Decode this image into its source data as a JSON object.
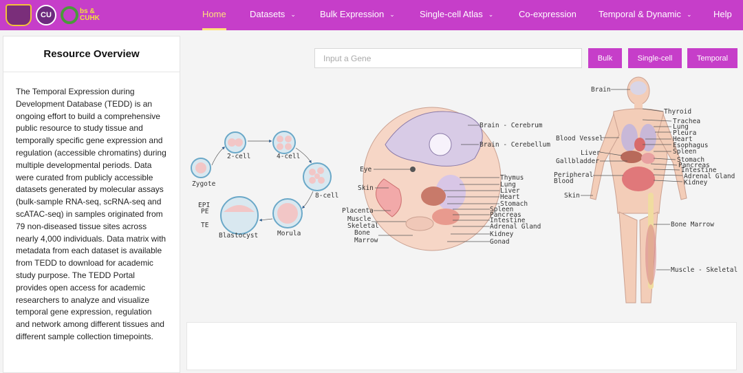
{
  "nav": {
    "logos": {
      "cu": "CU",
      "obs_text_1": "bs &",
      "obs_text_2": "CUHK"
    },
    "items": [
      {
        "label": "Home",
        "dropdown": false,
        "active": true
      },
      {
        "label": "Datasets",
        "dropdown": true
      },
      {
        "label": "Bulk Expression",
        "dropdown": true
      },
      {
        "label": "Single-cell Atlas",
        "dropdown": true
      },
      {
        "label": "Co-expression",
        "dropdown": false
      },
      {
        "label": "Temporal & Dynamic",
        "dropdown": true
      },
      {
        "label": "Help",
        "dropdown": false
      }
    ]
  },
  "overview": {
    "title": "Resource Overview",
    "text": "The Temporal Expression during Development Database (TEDD) is an ongoing effort to build a comprehensive public resource to study tissue and temporally specific gene expression and regulation (accessible chromatins) during multiple developmental periods. Data were curated from publicly accessible datasets generated by molecular assays (bulk-sample RNA-seq, scRNA-seq and scATAC-seq) in samples originated from 79 non-diseased tissue sites across nearly 4,000 individuals. Data matrix with metadata from each dataset is available from TEDD to download for academic study purpose. The TEDD Portal provides open access for academic researchers to analyze and visualize temporal gene expression, regulation and network among different tissues and different sample collection timepoints."
  },
  "search": {
    "placeholder": "Input a Gene",
    "buttons": [
      "Bulk",
      "Single-cell",
      "Temporal"
    ]
  },
  "figure": {
    "embryo_stages": {
      "zygote": "Zygote",
      "cell2": "2-cell",
      "cell4": "4-cell",
      "cell8": "8-cell",
      "morula": "Morula",
      "blastocyst": "Blastocyst",
      "epi": "EPI",
      "pe": "PE",
      "te": "TE"
    },
    "fetus_labels": {
      "cerebrum": "Brain - Cerebrum",
      "cerebellum": "Brain - Cerebellum",
      "eye": "Eye",
      "skin": "Skin",
      "placenta": "Placenta",
      "muscle": "Muscle",
      "skeletal": "Skeletal",
      "bone": "Bone",
      "marrow": "Marrow",
      "thymus": "Thymus",
      "lung": "Lung",
      "liver": "Liver",
      "heart": "Heart",
      "stomach": "Stomach",
      "spleen": "Spleen",
      "pancreas": "Pancreas",
      "intestine": "Intestine",
      "adrenal": "Adrenal Gland",
      "kidney": "Kidney",
      "gonad": "Gonad"
    },
    "adult_labels": {
      "brain": "Brain",
      "thyroid": "Thyroid",
      "trachea": "Trachea",
      "lung": "Lung",
      "pleura": "Pleura",
      "heart": "Heart",
      "esophagus": "Esophagus",
      "spleen": "Spleen",
      "stomach": "Stomach",
      "pancreas": "Pancreas",
      "intestine": "Intestine",
      "adrenal": "Adrenal Gland",
      "kidney": "Kidney",
      "blood_vessel": "Blood Vessel",
      "liver": "Liver",
      "gallbladder": "Gallbladder",
      "peripheral": "Peripheral",
      "blood": "Blood",
      "skin": "Skin",
      "bone_marrow": "Bone Marrow",
      "muscle_skeletal": "Muscle - Skeletal"
    }
  }
}
